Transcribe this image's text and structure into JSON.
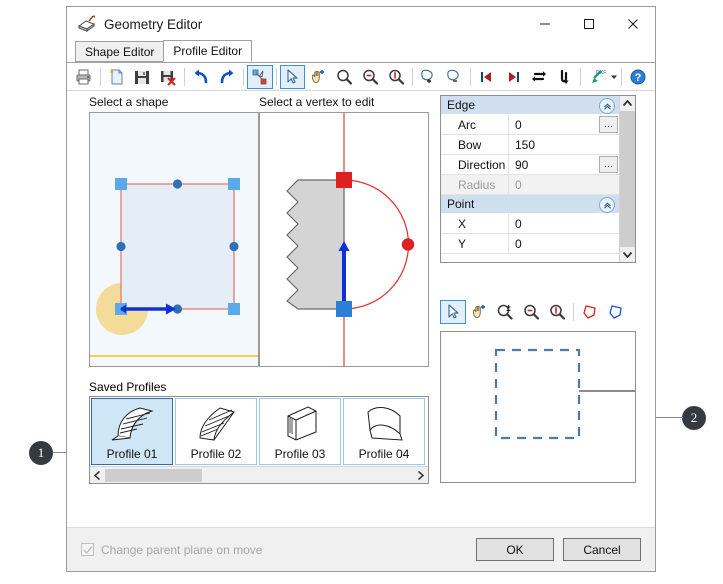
{
  "window": {
    "title": "Geometry Editor",
    "icon": "geometry-editor-icon",
    "minimize_label": "–",
    "maximize_label": "□",
    "close_label": "×"
  },
  "tabs": [
    {
      "label": "Shape Editor",
      "active": false
    },
    {
      "label": "Profile Editor",
      "active": true
    }
  ],
  "toolbar": {
    "items": [
      {
        "name": "print-icon",
        "selected": false
      },
      {
        "sep": true
      },
      {
        "name": "new-document-icon",
        "selected": false
      },
      {
        "name": "save-icon",
        "selected": false
      },
      {
        "name": "delete-save-icon",
        "selected": false
      },
      {
        "sep": true
      },
      {
        "name": "undo-icon",
        "selected": false
      },
      {
        "name": "redo-icon",
        "selected": false
      },
      {
        "sep": true
      },
      {
        "name": "edit-vertex-icon",
        "selected": true
      },
      {
        "sep": true
      },
      {
        "name": "select-arrow-icon",
        "selected": true
      },
      {
        "name": "pan-hand-icon",
        "selected": false
      },
      {
        "name": "zoom-icon",
        "selected": false
      },
      {
        "name": "zoom-out-icon",
        "selected": false
      },
      {
        "name": "zoom-reset-icon",
        "selected": false
      },
      {
        "sep": true
      },
      {
        "name": "add-region-icon",
        "selected": false
      },
      {
        "name": "remove-region-icon",
        "selected": false
      },
      {
        "sep": true
      },
      {
        "name": "first-step-icon",
        "selected": false
      },
      {
        "name": "last-step-icon",
        "selected": false
      },
      {
        "name": "flip-horizontal-icon",
        "selected": false
      },
      {
        "name": "flip-vertical-icon",
        "selected": false
      },
      {
        "sep": true
      },
      {
        "name": "dxf-export-icon",
        "selected": false,
        "caret": true
      },
      {
        "sep": true
      },
      {
        "name": "help-icon",
        "selected": false
      }
    ]
  },
  "shape_panel": {
    "label": "Select a shape"
  },
  "vertex_panel": {
    "label": "Select a vertex to edit"
  },
  "properties": {
    "groups": [
      {
        "title": "Edge",
        "collapse_icon": "collapse-chevron-icon",
        "rows": [
          {
            "name": "Arc",
            "value": "0",
            "readonly": false,
            "has_ellipsis": true
          },
          {
            "name": "Bow",
            "value": "150",
            "readonly": false,
            "has_ellipsis": false
          },
          {
            "name": "Direction",
            "value": "90",
            "readonly": false,
            "has_ellipsis": true
          },
          {
            "name": "Radius",
            "value": "0",
            "readonly": true,
            "has_ellipsis": false
          }
        ]
      },
      {
        "title": "Point",
        "collapse_icon": "collapse-chevron-icon",
        "rows": [
          {
            "name": "X",
            "value": "0",
            "readonly": false,
            "has_ellipsis": false
          },
          {
            "name": "Y",
            "value": "0",
            "readonly": false,
            "has_ellipsis": false
          }
        ]
      }
    ],
    "scroll_up": "▲",
    "scroll_down": "▼"
  },
  "mini_toolbar": {
    "items": [
      {
        "name": "select-arrow-icon",
        "selected": true
      },
      {
        "name": "pan-hand-icon",
        "selected": false
      },
      {
        "name": "zoom-window-icon",
        "selected": false
      },
      {
        "name": "zoom-out-icon",
        "selected": false
      },
      {
        "name": "zoom-reset-icon",
        "selected": false
      },
      {
        "sep": true
      },
      {
        "name": "region-red-icon",
        "selected": false
      },
      {
        "name": "region-blue-icon",
        "selected": false
      }
    ]
  },
  "saved_profiles": {
    "label": "Saved Profiles",
    "items": [
      {
        "name": "Profile 01",
        "selected": true,
        "thumb": "profile-curve-thumb"
      },
      {
        "name": "Profile 02",
        "selected": false,
        "thumb": "profile-wave-thumb"
      },
      {
        "name": "Profile 03",
        "selected": false,
        "thumb": "profile-block-thumb"
      },
      {
        "name": "Profile 04",
        "selected": false,
        "thumb": "profile-bend-thumb"
      }
    ],
    "scroll_left": "‹",
    "scroll_right": "›"
  },
  "footer": {
    "checkbox_label": "Change parent plane on move",
    "checkbox_checked": true,
    "checkbox_disabled": true,
    "ok_label": "OK",
    "cancel_label": "Cancel"
  },
  "callouts": [
    {
      "number": "1"
    },
    {
      "number": "2"
    }
  ],
  "colors": {
    "accent_blue": "#0f52ba",
    "shape_outline": "#e8827c",
    "handle_blue": "#5aaaea",
    "vertex_blue": "#2f6fb5",
    "arc_red": "#e03030",
    "highlight_yellow": "#f3dc9a",
    "preview_dashed": "#4b7ca8",
    "selection_bg": "#cfe6f7",
    "group_header": "#cfdff0"
  }
}
